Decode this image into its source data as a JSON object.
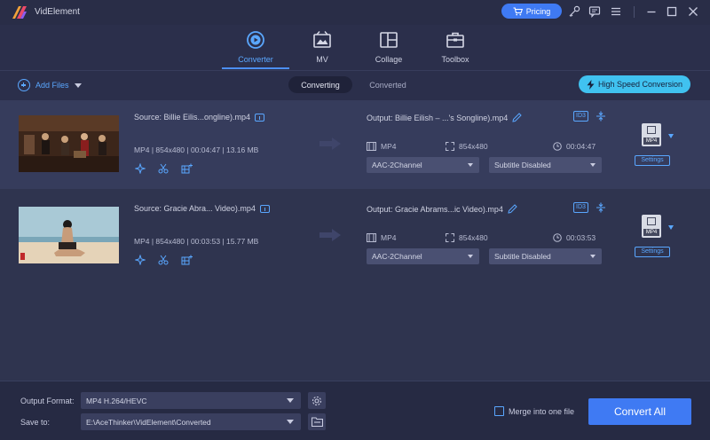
{
  "app": {
    "title": "VidElement"
  },
  "titlebar": {
    "pricing_label": "Pricing"
  },
  "nav": {
    "tabs": [
      {
        "label": "Converter",
        "icon": "converter-icon",
        "active": true
      },
      {
        "label": "MV",
        "icon": "mv-icon"
      },
      {
        "label": "Collage",
        "icon": "collage-icon"
      },
      {
        "label": "Toolbox",
        "icon": "toolbox-icon"
      }
    ]
  },
  "toolbar": {
    "add_files_label": "Add Files",
    "seg_converting": "Converting",
    "seg_converted": "Converted",
    "high_speed_label": "High Speed Conversion"
  },
  "files": [
    {
      "source": "Source: Billie Eilis...ongline).mp4",
      "meta": "MP4 | 854x480 | 00:04:47 | 13.16 MB",
      "output": "Output: Billie Eilish – ...'s Songline).mp4",
      "out_format": "MP4",
      "out_resolution": "854x480",
      "out_duration": "00:04:47",
      "audio": "AAC-2Channel",
      "subtitle": "Subtitle Disabled",
      "format_badge": "MP4",
      "settings_label": "Settings"
    },
    {
      "source": "Source: Gracie Abra... Video).mp4",
      "meta": "MP4 | 854x480 | 00:03:53 | 15.77 MB",
      "output": "Output: Gracie Abrams...ic Video).mp4",
      "out_format": "MP4",
      "out_resolution": "854x480",
      "out_duration": "00:03:53",
      "audio": "AAC-2Channel",
      "subtitle": "Subtitle Disabled",
      "format_badge": "MP4",
      "settings_label": "Settings"
    }
  ],
  "bottom": {
    "output_format_label": "Output Format:",
    "output_format_value": "MP4 H.264/HEVC",
    "save_to_label": "Save to:",
    "save_to_value": "E:\\AceThinker\\VidElement\\Converted",
    "merge_label": "Merge into one file",
    "convert_all_label": "Convert All"
  },
  "colors": {
    "accent": "#3f7af3",
    "accent_light": "#5aa7ff",
    "high_speed": "#40c2f0",
    "background": "#2b2f4b"
  }
}
